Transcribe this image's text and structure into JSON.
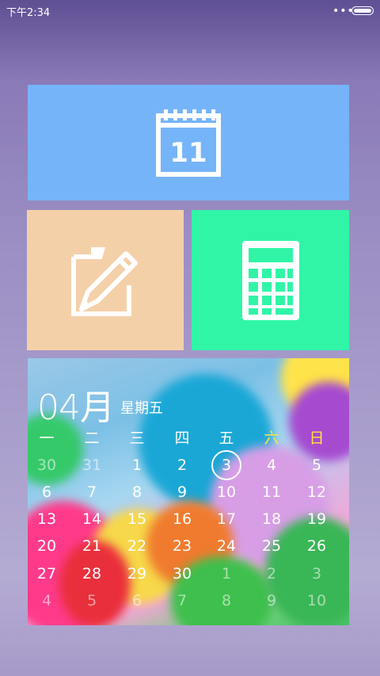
{
  "status_bar": {
    "time": "下午2:34",
    "dots": "•••"
  },
  "tiles": {
    "calendar": {
      "icon_number": "11",
      "color": "#76b4f9"
    },
    "notes": {
      "color": "#f4d0a9"
    },
    "calculator": {
      "color": "#30f5a7"
    }
  },
  "calendar_widget": {
    "month": "04月",
    "weekday": "星期五",
    "weekdays": [
      "一",
      "二",
      "三",
      "四",
      "五",
      "六",
      "日"
    ],
    "weekday_colors": [
      "#ffffff",
      "#ffffff",
      "#ffffff",
      "#ffffff",
      "#ffffff",
      "#ffe63a",
      "#ffe63a"
    ],
    "weeks": [
      [
        "30",
        "31",
        "1",
        "2",
        "3",
        "4",
        "5"
      ],
      [
        "6",
        "7",
        "8",
        "9",
        "10",
        "11",
        "12"
      ],
      [
        "13",
        "14",
        "15",
        "16",
        "17",
        "18",
        "19"
      ],
      [
        "20",
        "21",
        "22",
        "23",
        "24",
        "25",
        "26"
      ],
      [
        "27",
        "28",
        "29",
        "30",
        "1",
        "2",
        "3"
      ],
      [
        "4",
        "5",
        "6",
        "7",
        "8",
        "9",
        "10"
      ]
    ],
    "today": "3"
  }
}
